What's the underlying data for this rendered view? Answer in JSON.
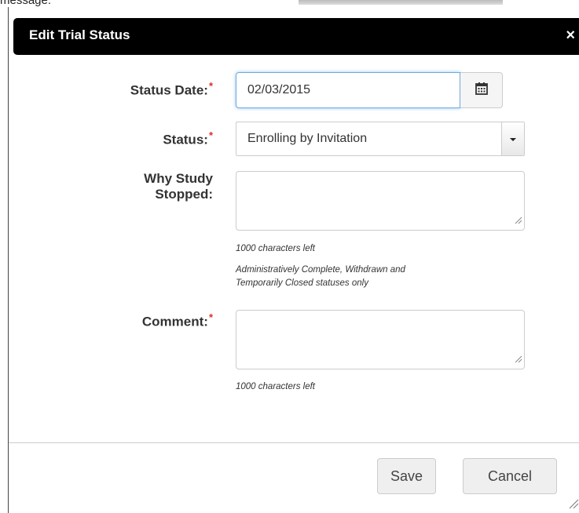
{
  "page": {
    "caption": "message:"
  },
  "dialog": {
    "title": "Edit Trial Status",
    "close_glyph": "×",
    "required_marker": "*",
    "fields": {
      "status_date": {
        "label": "Status Date:",
        "value": "02/03/2015"
      },
      "status": {
        "label": "Status:",
        "selected": "Enrolling by Invitation"
      },
      "why_stopped": {
        "label_line1": "Why Study",
        "label_line2": "Stopped:",
        "value": "",
        "chars_left": "1000 characters left",
        "note_line1": "Administratively Complete, Withdrawn and",
        "note_line2": "Temporarily Closed statuses only"
      },
      "comment": {
        "label": "Comment:",
        "value": "",
        "chars_left": "1000 characters left"
      }
    },
    "buttons": {
      "save": "Save",
      "cancel": "Cancel"
    },
    "colors": {
      "header_bg": "#000000",
      "required": "#d9302c",
      "focus_border": "#6fa8dc"
    },
    "icons": {
      "calendar": "calendar-icon",
      "dropdown": "caret-down-icon",
      "close": "close-icon"
    }
  }
}
